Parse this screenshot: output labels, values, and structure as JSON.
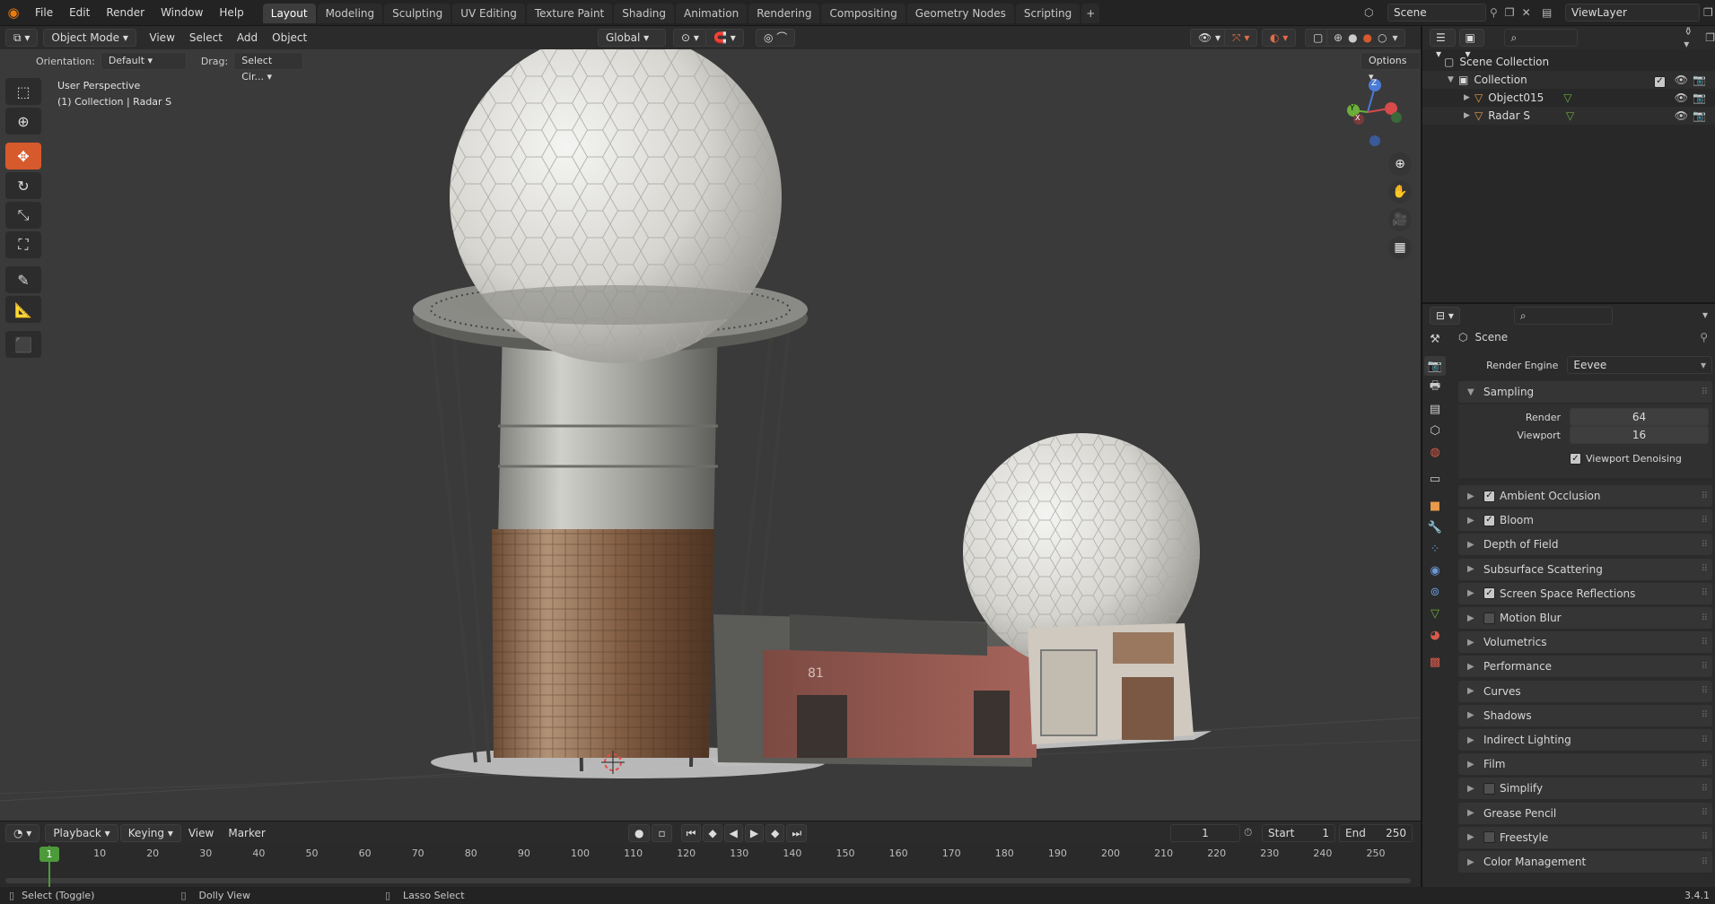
{
  "menubar": {
    "items": [
      "File",
      "Edit",
      "Render",
      "Window",
      "Help"
    ],
    "workspaces": [
      "Layout",
      "Modeling",
      "Sculpting",
      "UV Editing",
      "Texture Paint",
      "Shading",
      "Animation",
      "Rendering",
      "Compositing",
      "Geometry Nodes",
      "Scripting"
    ],
    "active_workspace": "Layout",
    "scene": "Scene",
    "view_layer": "ViewLayer"
  },
  "viewport_header": {
    "mode": "Object Mode",
    "menus": [
      "View",
      "Select",
      "Add",
      "Object"
    ],
    "transform_orientation": "Global",
    "orientation_label": "Orientation:",
    "orientation_value": "Default",
    "drag_label": "Drag:",
    "drag_value": "Select Cir...",
    "options": "Options"
  },
  "viewport": {
    "perspective": "User Perspective",
    "collection_info": "(1) Collection | Radar S",
    "gizmo_axes": [
      "Z",
      "Y",
      "X"
    ]
  },
  "timeline": {
    "menus": [
      "Playback",
      "Keying",
      "View",
      "Marker"
    ],
    "current_frame": "1",
    "start_label": "Start",
    "start": "1",
    "end_label": "End",
    "end": "250",
    "ticks": [
      "10",
      "20",
      "30",
      "40",
      "50",
      "60",
      "70",
      "80",
      "90",
      "100",
      "110",
      "120",
      "130",
      "140",
      "150",
      "160",
      "170",
      "180",
      "190",
      "200",
      "210",
      "220",
      "230",
      "240",
      "250"
    ],
    "playhead": "1"
  },
  "statusbar": {
    "hint1": "Select (Toggle)",
    "hint2": "Dolly View",
    "hint3": "Lasso Select",
    "version": "3.4.1"
  },
  "outliner": {
    "root": "Scene Collection",
    "collection": "Collection",
    "objects": [
      "Object015",
      "Radar S"
    ]
  },
  "properties": {
    "context": "Scene",
    "render_engine_label": "Render Engine",
    "render_engine": "Eevee",
    "sampling": {
      "title": "Sampling",
      "render_label": "Render",
      "render": "64",
      "viewport_label": "Viewport",
      "viewport": "16",
      "denoise_label": "Viewport Denoising"
    },
    "panels": [
      {
        "label": "Ambient Occlusion",
        "checkbox": true,
        "checked": true
      },
      {
        "label": "Bloom",
        "checkbox": true,
        "checked": true
      },
      {
        "label": "Depth of Field",
        "checkbox": false
      },
      {
        "label": "Subsurface Scattering",
        "checkbox": false
      },
      {
        "label": "Screen Space Reflections",
        "checkbox": true,
        "checked": true
      },
      {
        "label": "Motion Blur",
        "checkbox": true,
        "checked": false
      },
      {
        "label": "Volumetrics",
        "checkbox": false
      },
      {
        "label": "Performance",
        "checkbox": false
      },
      {
        "label": "Curves",
        "checkbox": false
      },
      {
        "label": "Shadows",
        "checkbox": false
      },
      {
        "label": "Indirect Lighting",
        "checkbox": false
      },
      {
        "label": "Film",
        "checkbox": false
      },
      {
        "label": "Simplify",
        "checkbox": true,
        "checked": false
      },
      {
        "label": "Grease Pencil",
        "checkbox": false
      },
      {
        "label": "Freestyle",
        "checkbox": true,
        "checked": false
      },
      {
        "label": "Color Management",
        "checkbox": false
      }
    ]
  },
  "colors": {
    "accent": "#d75a2c",
    "playhead": "#4c9a3a"
  }
}
